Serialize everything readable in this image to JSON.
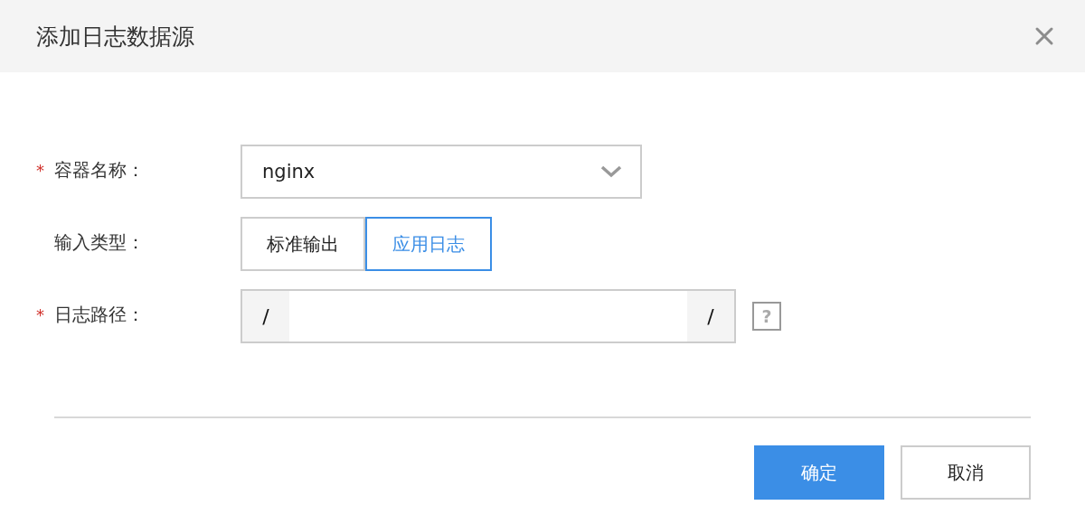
{
  "dialog": {
    "title": "添加日志数据源"
  },
  "required_mark": "*",
  "fields": [
    {
      "kind": "select",
      "required": true,
      "label": "容器名称：",
      "value": "nginx"
    },
    {
      "kind": "segmented",
      "required": false,
      "label": "输入类型：",
      "options": [
        {
          "label": "标准输出",
          "selected": false
        },
        {
          "label": "应用日志",
          "selected": true
        }
      ]
    },
    {
      "kind": "path",
      "required": true,
      "label": "日志路径：",
      "prefix": "/",
      "suffix": "/",
      "help": "?"
    }
  ],
  "buttons": [
    {
      "kind": "primary",
      "label": "确定"
    },
    {
      "kind": "default",
      "label": "取消"
    }
  ]
}
